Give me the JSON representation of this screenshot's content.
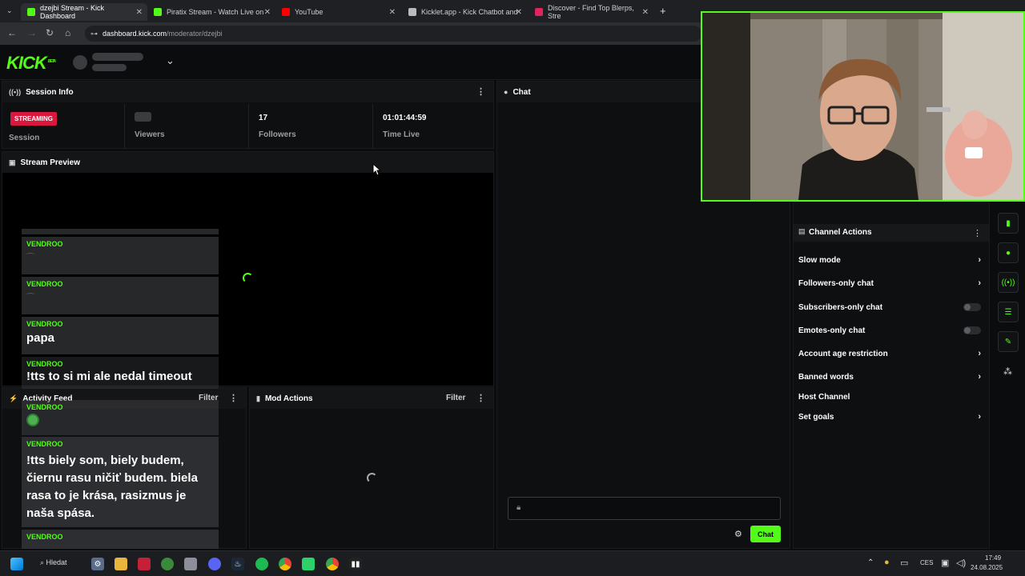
{
  "browser": {
    "tabs": [
      {
        "title": "dzejbi Stream - Kick Dashboard",
        "active": true,
        "favicon_color": "#53fc18"
      },
      {
        "title": "Piratix Stream - Watch Live on",
        "active": false,
        "favicon_color": "#53fc18"
      },
      {
        "title": "YouTube",
        "active": false,
        "favicon_color": "#ff0000"
      },
      {
        "title": "Kicklet.app - Kick Chatbot and",
        "active": false,
        "favicon_color": "#bbbbbb"
      },
      {
        "title": "Discover - Find Top Blerps, Stre",
        "active": false,
        "favicon_color": "#e0245e"
      }
    ],
    "url_host": "dashboard.kick.com",
    "url_path": "/moderator/dzejbi"
  },
  "kick": {
    "logo": "KICK",
    "logo_tag": "BETA"
  },
  "session_info": {
    "title": "Session Info",
    "badge": "STREAMING",
    "session_label": "Session",
    "viewers_label": "Viewers",
    "followers_value": "17",
    "followers_label": "Followers",
    "time_value": "01:01:44:59",
    "time_label": "Time Live"
  },
  "stream_preview": {
    "title": "Stream Preview"
  },
  "activity_feed": {
    "title": "Activity Feed",
    "filter": "Filter"
  },
  "mod_actions": {
    "title": "Mod Actions",
    "filter": "Filter"
  },
  "chat": {
    "title": "Chat",
    "send_label": "Chat"
  },
  "overlay_messages": [
    {
      "user": "VENDROO",
      "text": "",
      "emote": true
    },
    {
      "user": "VENDROO",
      "text": "",
      "emote": true
    },
    {
      "user": "VENDROO",
      "text": "papa",
      "emote": false
    },
    {
      "user": "VENDROO",
      "text": "!tts to si mi ale nedal timeout",
      "emote": false
    },
    {
      "user": "VENDROO",
      "text": "",
      "emote": true
    },
    {
      "user": "VENDROO",
      "text": "!tts biely som, biely budem, čiernu rasu ničiť budem. biela rasa to je krása, rasizmus je naša spása.",
      "emote": false
    },
    {
      "user": "VENDROO",
      "text": "",
      "emote": false
    }
  ],
  "channel_actions": {
    "title": "Channel Actions",
    "items": [
      {
        "label": "Slow mode",
        "control": "chevron"
      },
      {
        "label": "Followers-only chat",
        "control": "chevron"
      },
      {
        "label": "Subscribers-only chat",
        "control": "toggle"
      },
      {
        "label": "Emotes-only chat",
        "control": "toggle"
      },
      {
        "label": "Account age restriction",
        "control": "chevron"
      },
      {
        "label": "Banned words",
        "control": "chevron"
      },
      {
        "label": "Host Channel",
        "control": "none"
      },
      {
        "label": "Set goals",
        "control": "chevron"
      }
    ]
  },
  "taskbar": {
    "search_label": "Hledat",
    "language": "CES",
    "time": "17:49",
    "date": "24.08.2025"
  },
  "colors": {
    "accent": "#53fc18",
    "live": "#d8183f"
  }
}
